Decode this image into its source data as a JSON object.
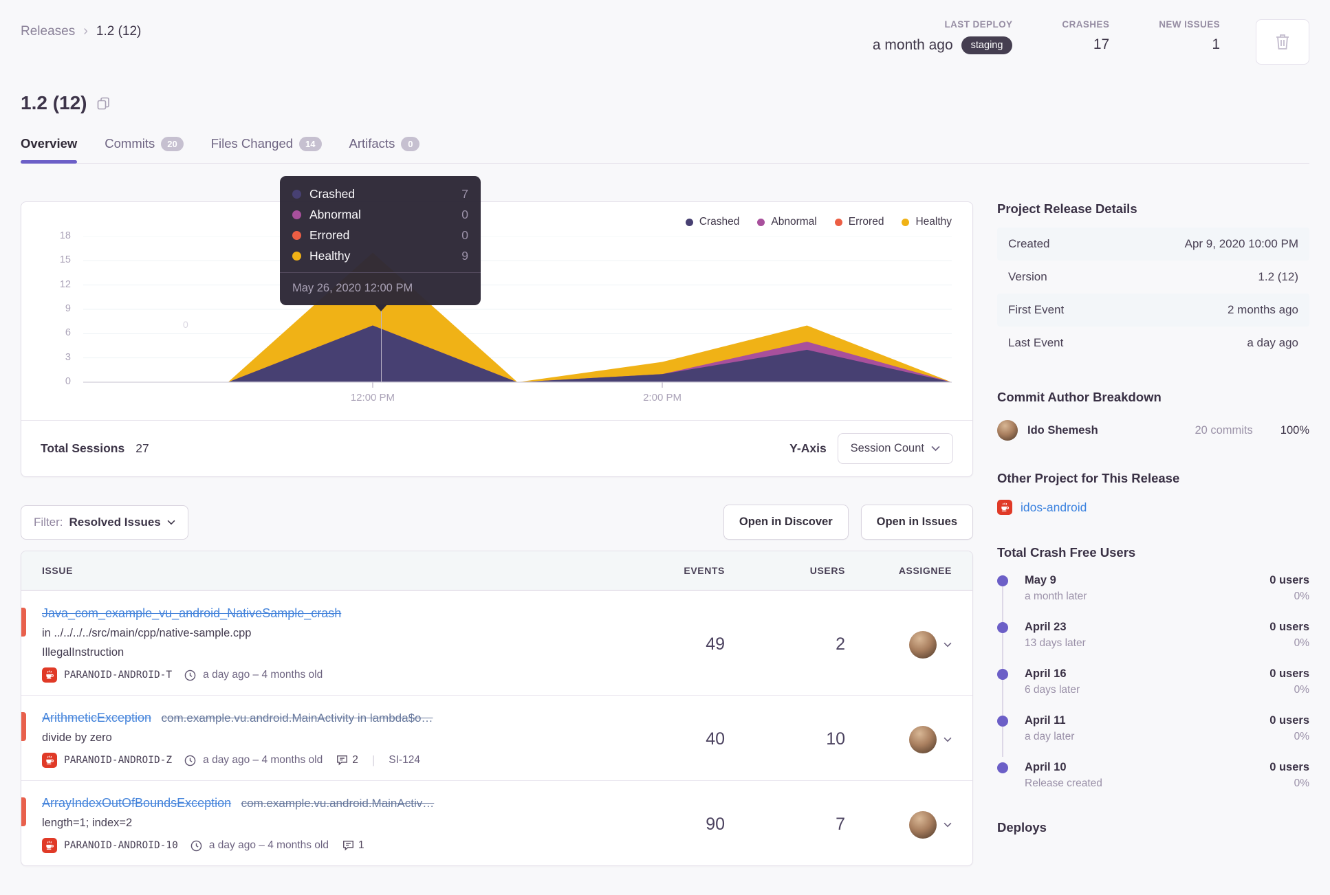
{
  "breadcrumb": {
    "parent": "Releases",
    "current": "1.2 (12)"
  },
  "header_stats": {
    "last_deploy": {
      "label": "LAST DEPLOY",
      "value": "a month ago",
      "env": "staging"
    },
    "crashes": {
      "label": "CRASHES",
      "value": "17"
    },
    "new_issues": {
      "label": "NEW ISSUES",
      "value": "1"
    }
  },
  "release": {
    "title": "1.2 (12)"
  },
  "tabs": [
    {
      "label": "Overview",
      "active": true
    },
    {
      "label": "Commits",
      "badge": "20"
    },
    {
      "label": "Files Changed",
      "badge": "14"
    },
    {
      "label": "Artifacts",
      "badge": "0"
    }
  ],
  "chart_data": {
    "type": "area",
    "stacked": true,
    "x_hours": [
      "10:00 AM",
      "11:00 AM",
      "12:00 PM",
      "1:00 PM",
      "2:00 PM",
      "3:00 PM",
      "4:00 PM"
    ],
    "series": [
      {
        "name": "Crashed",
        "color": "#474072",
        "values": [
          0,
          0,
          7,
          0,
          1,
          4,
          0
        ]
      },
      {
        "name": "Abnormal",
        "color": "#a8509c",
        "values": [
          0,
          0,
          0,
          0,
          0,
          1,
          0
        ]
      },
      {
        "name": "Errored",
        "color": "#ec5e44",
        "values": [
          0,
          0,
          0,
          0,
          0,
          0,
          0
        ]
      },
      {
        "name": "Healthy",
        "color": "#f0b216",
        "values": [
          0,
          0,
          9,
          0,
          1.5,
          2,
          0
        ]
      }
    ],
    "ylim": [
      0,
      18
    ],
    "yticks": [
      0,
      3,
      6,
      9,
      12,
      15,
      18
    ],
    "xticks": [
      {
        "label": "12:00 PM",
        "frac": 0.3333
      },
      {
        "label": "2:00 PM",
        "frac": 0.6667
      }
    ],
    "grid": true,
    "legend_position": "top-right",
    "ghost_label": "0",
    "tooltip": {
      "rows": [
        {
          "label": "Crashed",
          "value": "7"
        },
        {
          "label": "Abnormal",
          "value": "0"
        },
        {
          "label": "Errored",
          "value": "0"
        },
        {
          "label": "Healthy",
          "value": "9"
        }
      ],
      "footer": "May 26, 2020 12:00 PM"
    }
  },
  "chart_footer": {
    "total_sessions_label": "Total Sessions",
    "total_sessions_value": "27",
    "y_axis_label": "Y-Axis",
    "y_axis_value": "Session Count"
  },
  "filter_bar": {
    "filter_label": "Filter:",
    "filter_value": "Resolved Issues",
    "open_discover": "Open in Discover",
    "open_issues": "Open in Issues"
  },
  "issues_table": {
    "columns": {
      "issue": "ISSUE",
      "events": "EVENTS",
      "users": "USERS",
      "assignee": "ASSIGNEE"
    },
    "rows": [
      {
        "title": "Java_com_example_vu_android_NativeSample_crash",
        "culprit": "in ../../../../src/main/cpp/native-sample.cpp",
        "message": "IllegalInstruction",
        "project": "PARANOID-ANDROID-T",
        "age": "a day ago – 4 months old",
        "events": "49",
        "users": "2"
      },
      {
        "title": "ArithmeticException",
        "title_extra": "com.example.vu.android.MainActivity in lambda$o…",
        "message": "divide by zero",
        "project": "PARANOID-ANDROID-Z",
        "age": "a day ago – 4 months old",
        "comments": "2",
        "annotation": "SI-124",
        "events": "40",
        "users": "10"
      },
      {
        "title": "ArrayIndexOutOfBoundsException",
        "title_extra": "com.example.vu.android.MainActiv…",
        "message": "length=1; index=2",
        "project": "PARANOID-ANDROID-10",
        "age": "a day ago – 4 months old",
        "comments": "1",
        "events": "90",
        "users": "7"
      }
    ]
  },
  "sidebar": {
    "details": {
      "title": "Project Release Details",
      "rows": [
        {
          "label": "Created",
          "value": "Apr 9, 2020 10:00 PM"
        },
        {
          "label": "Version",
          "value": "1.2 (12)"
        },
        {
          "label": "First Event",
          "value": "2 months ago"
        },
        {
          "label": "Last Event",
          "value": "a day ago"
        }
      ]
    },
    "authors": {
      "title": "Commit Author Breakdown",
      "name": "Ido Shemesh",
      "commits": "20 commits",
      "percent": "100%"
    },
    "other_project": {
      "title": "Other Project for This Release",
      "link": "idos-android"
    },
    "crash_free": {
      "title": "Total Crash Free Users",
      "entries": [
        {
          "date": "May 9",
          "sub": "a month later",
          "users": "0 users",
          "pct": "0%"
        },
        {
          "date": "April 23",
          "sub": "13 days later",
          "users": "0 users",
          "pct": "0%"
        },
        {
          "date": "April 16",
          "sub": "6 days later",
          "users": "0 users",
          "pct": "0%"
        },
        {
          "date": "April 11",
          "sub": "a day later",
          "users": "0 users",
          "pct": "0%"
        },
        {
          "date": "April 10",
          "sub": "Release created",
          "users": "0 users",
          "pct": "0%"
        }
      ]
    },
    "deploys_title": "Deploys"
  },
  "icons": {
    "chevron_down_glyph": "⌄",
    "breadcrumb_sep_glyph": "›"
  }
}
